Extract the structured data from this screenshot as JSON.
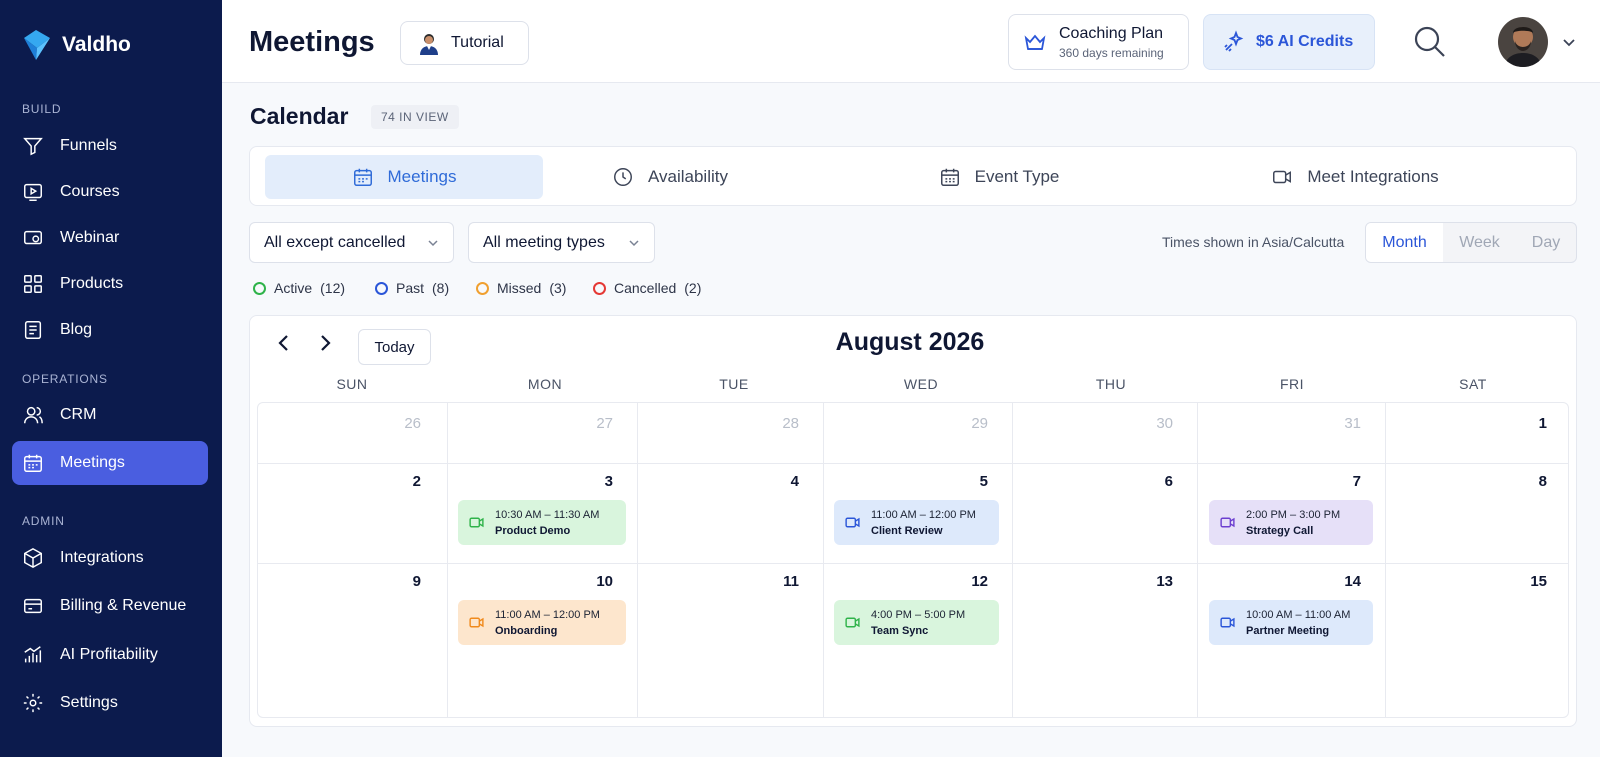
{
  "app": {
    "name": "Valdho"
  },
  "sidebar": {
    "sections": [
      {
        "label": "BUILD"
      },
      {
        "label": "OPERATIONS"
      },
      {
        "label": "ADMIN"
      }
    ],
    "items": [
      {
        "label": "Funnels",
        "icon": "funnel-icon"
      },
      {
        "label": "Courses",
        "icon": "play-icon"
      },
      {
        "label": "Webinar",
        "icon": "webinar-icon"
      },
      {
        "label": "Products",
        "icon": "grid-icon"
      },
      {
        "label": "Blog",
        "icon": "blog-icon"
      },
      {
        "label": "CRM",
        "icon": "users-icon"
      },
      {
        "label": "Meetings",
        "icon": "calendar-icon",
        "active": true
      },
      {
        "label": "Integrations",
        "icon": "cube-icon"
      },
      {
        "label": "Billing & Revenue",
        "icon": "card-icon"
      },
      {
        "label": "AI Profitability",
        "icon": "bar-chart-icon"
      },
      {
        "label": "Settings",
        "icon": "gear-icon"
      }
    ]
  },
  "header": {
    "title": "Meetings",
    "tutorial_label": "Tutorial",
    "plan_title": "Coaching Plan",
    "plan_sub": "360 days remaining",
    "credits_label": "$6 AI Credits"
  },
  "calendar": {
    "title": "Calendar",
    "count_badge": "74 IN VIEW",
    "tabs": [
      {
        "label": "Meetings",
        "icon": "calendar-icon",
        "active": true
      },
      {
        "label": "Availability",
        "icon": "clock-icon"
      },
      {
        "label": "Event Type",
        "icon": "calendar-grid-icon"
      },
      {
        "label": "Meet Integrations",
        "icon": "video-icon"
      }
    ],
    "filters": {
      "status": "All except cancelled",
      "types": "All meeting types"
    },
    "timezone_note": "Times shown in Asia/Calcutta",
    "views": [
      "Month",
      "Week",
      "Day"
    ],
    "active_view": "Month",
    "legend": [
      {
        "label": "Active",
        "count": "(12)",
        "color": "#2fb34a"
      },
      {
        "label": "Past",
        "count": "(8)",
        "color": "#2b56d8"
      },
      {
        "label": "Missed",
        "count": "(3)",
        "color": "#f0a030"
      },
      {
        "label": "Cancelled",
        "count": "(2)",
        "color": "#e53935"
      }
    ],
    "today_label": "Today",
    "month_title": "August 2026",
    "weekdays": [
      "SUN",
      "MON",
      "TUE",
      "WED",
      "THU",
      "FRI",
      "SAT"
    ],
    "weeks": [
      [
        "26",
        "27",
        "28",
        "29",
        "30",
        "31",
        "1"
      ],
      [
        "2",
        "3",
        "4",
        "5",
        "6",
        "7",
        "8"
      ],
      [
        "9",
        "10",
        "11",
        "12",
        "13",
        "14",
        "15"
      ]
    ],
    "events": [
      {
        "time": "10:30 AM – 11:30 AM",
        "title": "Product Demo",
        "color": "#2fb34a"
      },
      {
        "time": "11:00 AM – 12:00 PM",
        "title": "Client Review",
        "color": "#2b56d8"
      },
      {
        "time": "2:00 PM – 3:00 PM",
        "title": "Strategy Call",
        "color": "#6c3fd0"
      },
      {
        "time": "11:00 AM – 12:00 PM",
        "title": "Onboarding",
        "color": "#f08a1c"
      },
      {
        "time": "4:00 PM – 5:00 PM",
        "title": "Team Sync",
        "color": "#2fb34a"
      },
      {
        "time": "10:00 AM – 11:00 AM",
        "title": "Partner Meeting",
        "color": "#2b56d8"
      }
    ]
  }
}
